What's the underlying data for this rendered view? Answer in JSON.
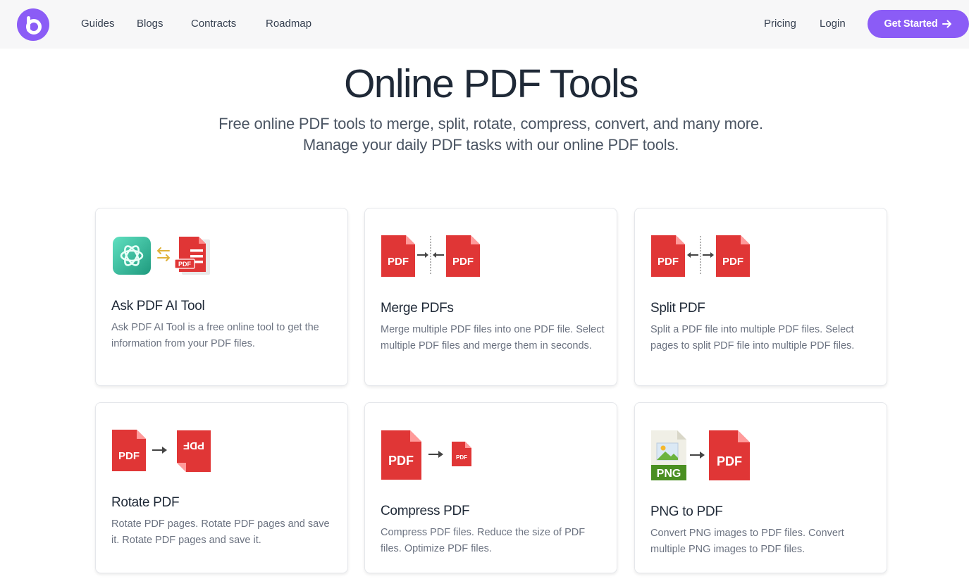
{
  "nav": {
    "links": [
      "Guides",
      "Blogs",
      "Contracts",
      "Roadmap"
    ],
    "pricing": "Pricing",
    "login": "Login",
    "cta": "Get Started",
    "cta_icon": "arrow-right-icon"
  },
  "hero": {
    "title": "Online PDF Tools",
    "subtitle_line1": "Free online PDF tools to merge, split, rotate, compress, convert, and many more.",
    "subtitle_line2": "Manage your daily PDF tasks with our online PDF tools."
  },
  "colors": {
    "brand": "#8b5cf6",
    "pdf_red": "#e03636",
    "nav_bg": "#f7f7f8"
  },
  "icon_text": {
    "pdf": "PDF",
    "png": "PNG"
  },
  "cards": [
    {
      "title": "Ask PDF AI Tool",
      "description": "Ask PDF AI Tool is a free online tool to get the information from your PDF files.",
      "icon": "chatgpt-to-pdf-icon"
    },
    {
      "title": "Merge PDFs",
      "description": "Merge multiple PDF files into one PDF file. Select multiple PDF files and merge them in seconds.",
      "icon": "merge-pdf-icon"
    },
    {
      "title": "Split PDF",
      "description": "Split a PDF file into multiple PDF files. Select pages to split PDF file into multiple PDF files.",
      "icon": "split-pdf-icon"
    },
    {
      "title": "Rotate PDF",
      "description": "Rotate PDF pages. Rotate PDF pages and save it. Rotate PDF pages and save it.",
      "icon": "rotate-pdf-icon"
    },
    {
      "title": "Compress PDF",
      "description": "Compress PDF files. Reduce the size of PDF files. Optimize PDF files.",
      "icon": "compress-pdf-icon"
    },
    {
      "title": "PNG to PDF",
      "description": "Convert PNG images to PDF files. Convert multiple PNG images to PDF files.",
      "icon": "png-to-pdf-icon"
    }
  ]
}
